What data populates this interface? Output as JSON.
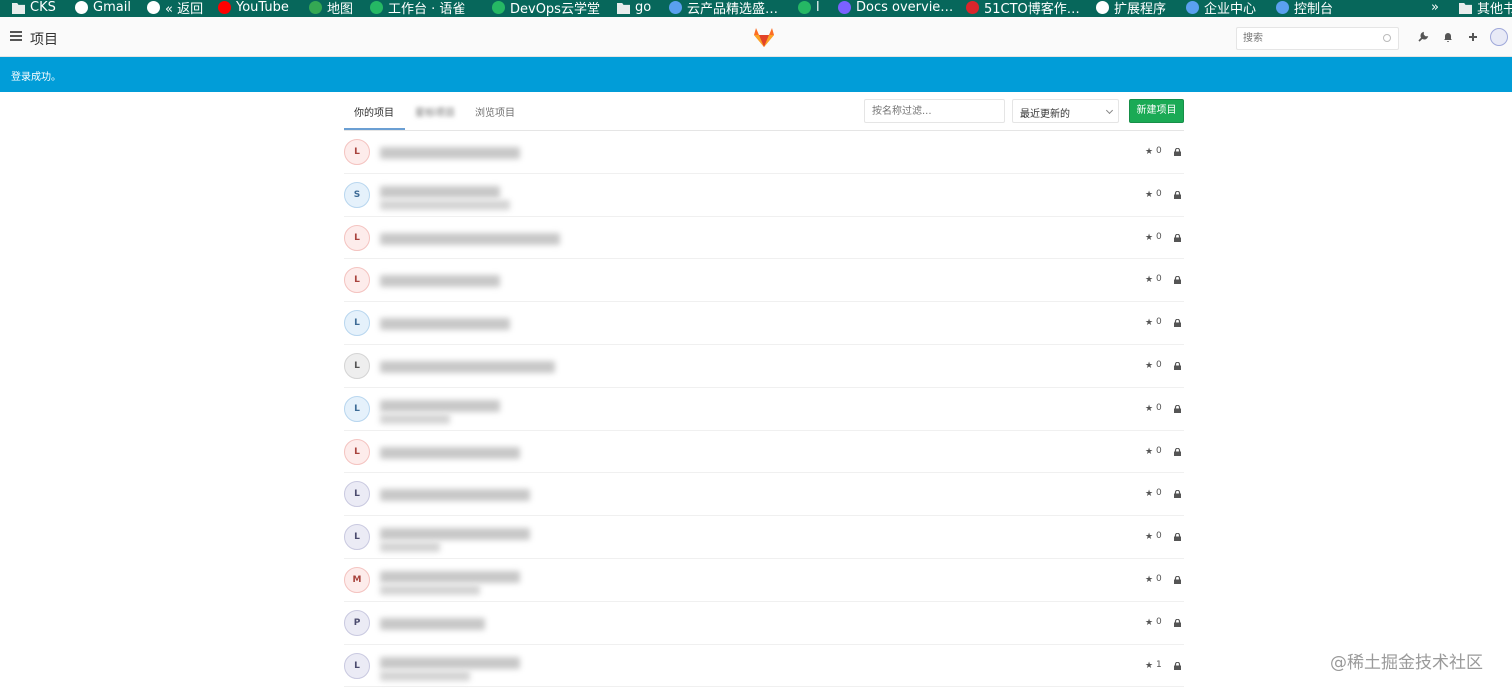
{
  "bookmarks": [
    {
      "label": "CKS",
      "icon": "folder-icon",
      "color": "#e8ecec"
    },
    {
      "label": "Gmail",
      "icon": "google-icon",
      "color": "#ffffff"
    },
    {
      "label": "« 返回",
      "icon": "globe-icon",
      "color": "#ffffff"
    },
    {
      "label": "YouTube",
      "icon": "youtube-icon",
      "color": "#ff0000"
    },
    {
      "label": "地图",
      "icon": "maps-icon",
      "color": "#34a853"
    },
    {
      "label": "工作台 · 语雀",
      "icon": "yuque-icon",
      "color": "#25b864"
    },
    {
      "label": "DevOps云学堂",
      "icon": "devops-icon",
      "color": "#25b864"
    },
    {
      "label": "go",
      "icon": "folder-icon",
      "color": "#e8ecec"
    },
    {
      "label": "云产品精选盛…",
      "icon": "cloud-icon",
      "color": "#5aa0f0"
    },
    {
      "label": "l",
      "icon": "app-icon",
      "color": "#25b864"
    },
    {
      "label": "Docs overvie…",
      "icon": "docs-icon",
      "color": "#7b61ff"
    },
    {
      "label": "51CTO博客作…",
      "icon": "51cto-icon",
      "color": "#d9262c"
    },
    {
      "label": "扩展程序",
      "icon": "puzzle-icon",
      "color": "#ffffff"
    },
    {
      "label": "企业中心",
      "icon": "cloud-icon",
      "color": "#5aa0f0"
    },
    {
      "label": "控制台",
      "icon": "cloud-icon",
      "color": "#5aa0f0"
    },
    {
      "label": "»",
      "icon": "",
      "color": ""
    },
    {
      "label": "其他书",
      "icon": "folder-icon",
      "color": "#e8ecec"
    }
  ],
  "nav": {
    "title": "项目",
    "search_placeholder": "搜索"
  },
  "flash": {
    "message": "登录成功。"
  },
  "tabs": [
    {
      "label": "你的项目",
      "active": true
    },
    {
      "label": "星标项目",
      "active": false
    },
    {
      "label": "浏览项目",
      "active": false
    }
  ],
  "filter": {
    "placeholder": "按名称过滤..."
  },
  "sort": {
    "selected": "最近更新的"
  },
  "new_project": {
    "label": "新建项目"
  },
  "projects": [
    {
      "initial": "L",
      "stars": "0",
      "avatar_bg": "#fdeceb",
      "avatar_border": "#f4c3c0",
      "avatar_fg": "#a8433d"
    },
    {
      "initial": "S",
      "stars": "0",
      "avatar_bg": "#e5f1fb",
      "avatar_border": "#b8d6ef",
      "avatar_fg": "#3d6b96"
    },
    {
      "initial": "L",
      "stars": "0",
      "avatar_bg": "#fdeceb",
      "avatar_border": "#f4c3c0",
      "avatar_fg": "#a8433d"
    },
    {
      "initial": "L",
      "stars": "0",
      "avatar_bg": "#fdeceb",
      "avatar_border": "#f4c3c0",
      "avatar_fg": "#a8433d"
    },
    {
      "initial": "L",
      "stars": "0",
      "avatar_bg": "#e5f1fb",
      "avatar_border": "#b8d6ef",
      "avatar_fg": "#3d6b96"
    },
    {
      "initial": "L",
      "stars": "0",
      "avatar_bg": "#eeeeee",
      "avatar_border": "#d4d4d4",
      "avatar_fg": "#555555"
    },
    {
      "initial": "L",
      "stars": "0",
      "avatar_bg": "#e5f1fb",
      "avatar_border": "#b8d6ef",
      "avatar_fg": "#3d6b96"
    },
    {
      "initial": "L",
      "stars": "0",
      "avatar_bg": "#fdeceb",
      "avatar_border": "#f4c3c0",
      "avatar_fg": "#a8433d"
    },
    {
      "initial": "L",
      "stars": "0",
      "avatar_bg": "#ebebf5",
      "avatar_border": "#c9c9e0",
      "avatar_fg": "#4b4b6e"
    },
    {
      "initial": "L",
      "stars": "0",
      "avatar_bg": "#ebebf5",
      "avatar_border": "#c9c9e0",
      "avatar_fg": "#4b4b6e"
    },
    {
      "initial": "M",
      "stars": "0",
      "avatar_bg": "#fdeceb",
      "avatar_border": "#f4c3c0",
      "avatar_fg": "#a8433d"
    },
    {
      "initial": "P",
      "stars": "0",
      "avatar_bg": "#ebebf5",
      "avatar_border": "#c9c9e0",
      "avatar_fg": "#4b4b6e"
    },
    {
      "initial": "L",
      "stars": "1",
      "avatar_bg": "#ebebf5",
      "avatar_border": "#c9c9e0",
      "avatar_fg": "#4b4b6e"
    }
  ],
  "watermark": "@稀土掘金技术社区",
  "colors": {
    "bookmark_bar": "#07675b",
    "flash": "#019dd8",
    "new_button": "#1aaa55",
    "tab_underline": "#6b9fd3",
    "gitlab_orange": "#fc6d26"
  }
}
